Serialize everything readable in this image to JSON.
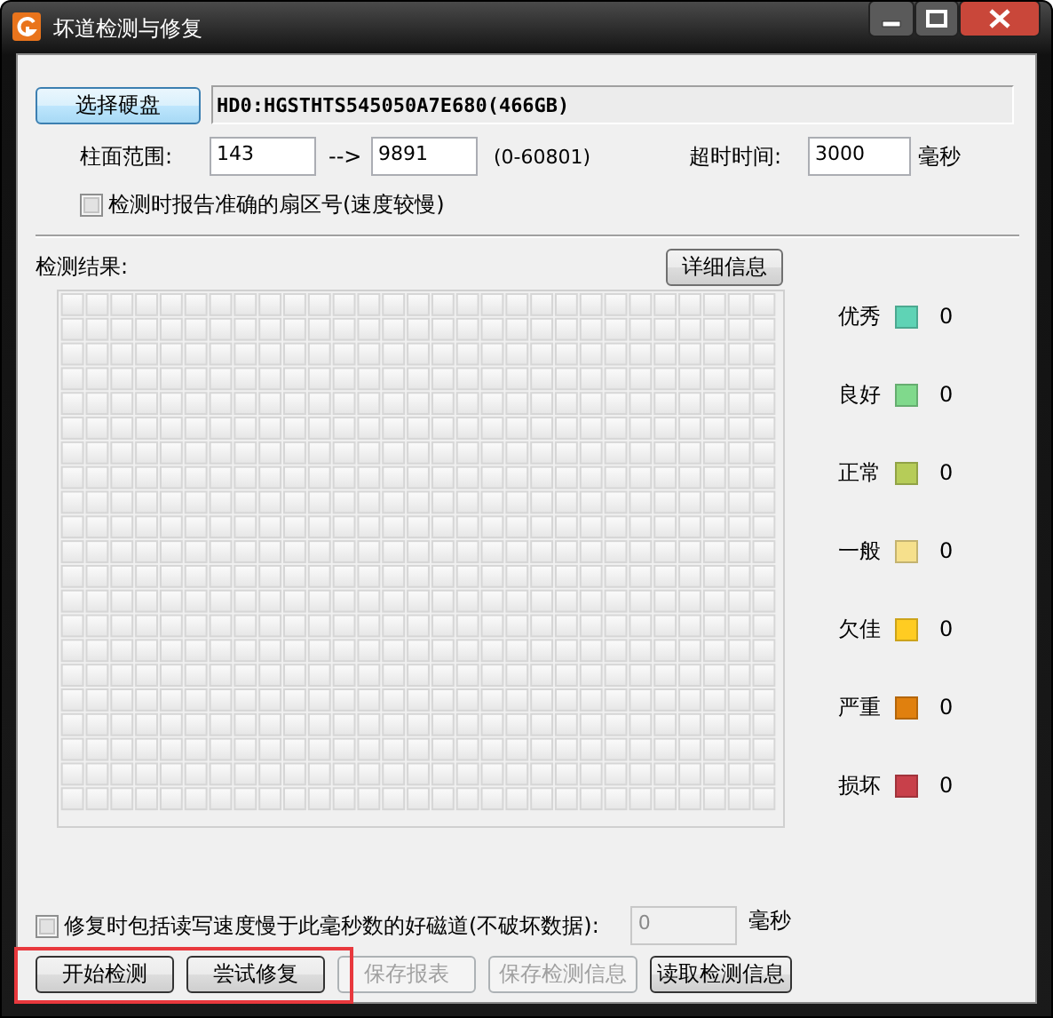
{
  "window": {
    "title": "坏道检测与修复"
  },
  "drive": {
    "button": "选择硬盘",
    "info": "HD0:HGSTHTS545050A7E680(466GB)"
  },
  "range": {
    "label": "柱面范围:",
    "from": "143",
    "arrow": "-->",
    "to": "9891",
    "hint": "(0-60801)"
  },
  "timeout": {
    "label": "超时时间:",
    "value": "3000",
    "unit": "毫秒"
  },
  "report_option": {
    "label": "检测时报告准确的扇区号(速度较慢)",
    "checked": false
  },
  "results": {
    "label": "检测结果:",
    "detail_button": "详细信息"
  },
  "legend": [
    {
      "label": "优秀",
      "color": "#5fd3b5",
      "count": "0"
    },
    {
      "label": "良好",
      "color": "#80d98c",
      "count": "0"
    },
    {
      "label": "正常",
      "color": "#b6cc58",
      "count": "0"
    },
    {
      "label": "一般",
      "color": "#f6e08c",
      "count": "0"
    },
    {
      "label": "欠佳",
      "color": "#ffcc22",
      "count": "0"
    },
    {
      "label": "严重",
      "color": "#e0800e",
      "count": "0"
    },
    {
      "label": "损坏",
      "color": "#c8404a",
      "count": "0"
    }
  ],
  "repair_option": {
    "label": "修复时包括读写速度慢于此毫秒数的好磁道(不破坏数据):",
    "checked": false,
    "value": "0",
    "unit": "毫秒"
  },
  "buttons": [
    {
      "label": "开始检测",
      "disabled": false
    },
    {
      "label": "尝试修复",
      "disabled": false
    },
    {
      "label": "保存报表",
      "disabled": true
    },
    {
      "label": "保存检测信息",
      "disabled": true
    },
    {
      "label": "读取检测信息",
      "disabled": false
    }
  ]
}
